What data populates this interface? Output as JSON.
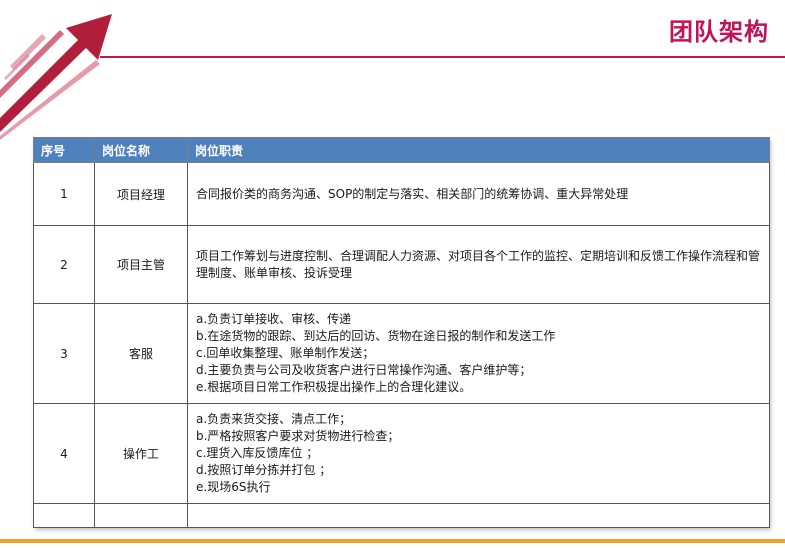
{
  "header": {
    "title": "团队架构"
  },
  "table": {
    "columns": [
      "序号",
      "岗位名称",
      "岗位职责"
    ],
    "rows": [
      {
        "num": "1",
        "role": "项目经理",
        "duties": [
          "合同报价类的商务沟通、SOP的制定与落实、相关部门的统筹协调、重大异常处理"
        ]
      },
      {
        "num": "2",
        "role": "项目主管",
        "duties": [
          "项目工作筹划与进度控制、合理调配人力资源、对项目各个工作的监控、定期培训和反馈工作操作流程和管理制度、账单审核、投诉受理"
        ]
      },
      {
        "num": "3",
        "role": "客服",
        "duties": [
          "a.负责订单接收、审核、传递",
          "b.在途货物的跟踪、到达后的回访、货物在途日报的制作和发送工作",
          "c.回单收集整理、账单制作发送；",
          "d.主要负责与公司及收货客户进行日常操作沟通、客户维护等；",
          "e.根据项目日常工作积极提出操作上的合理化建议。"
        ]
      },
      {
        "num": "4",
        "role": "操作工",
        "duties": [
          "a.负责来货交接、清点工作；",
          "b.严格按照客户要求对货物进行检查；",
          "c.理货入库反馈库位 ；",
          "d.按照订单分拣并打包 ；",
          "e.现场6S执行"
        ]
      }
    ]
  },
  "colors": {
    "accent": "#c0145a",
    "header_fill": "#4f81bd",
    "bottom_rule": "#f0a22a"
  }
}
